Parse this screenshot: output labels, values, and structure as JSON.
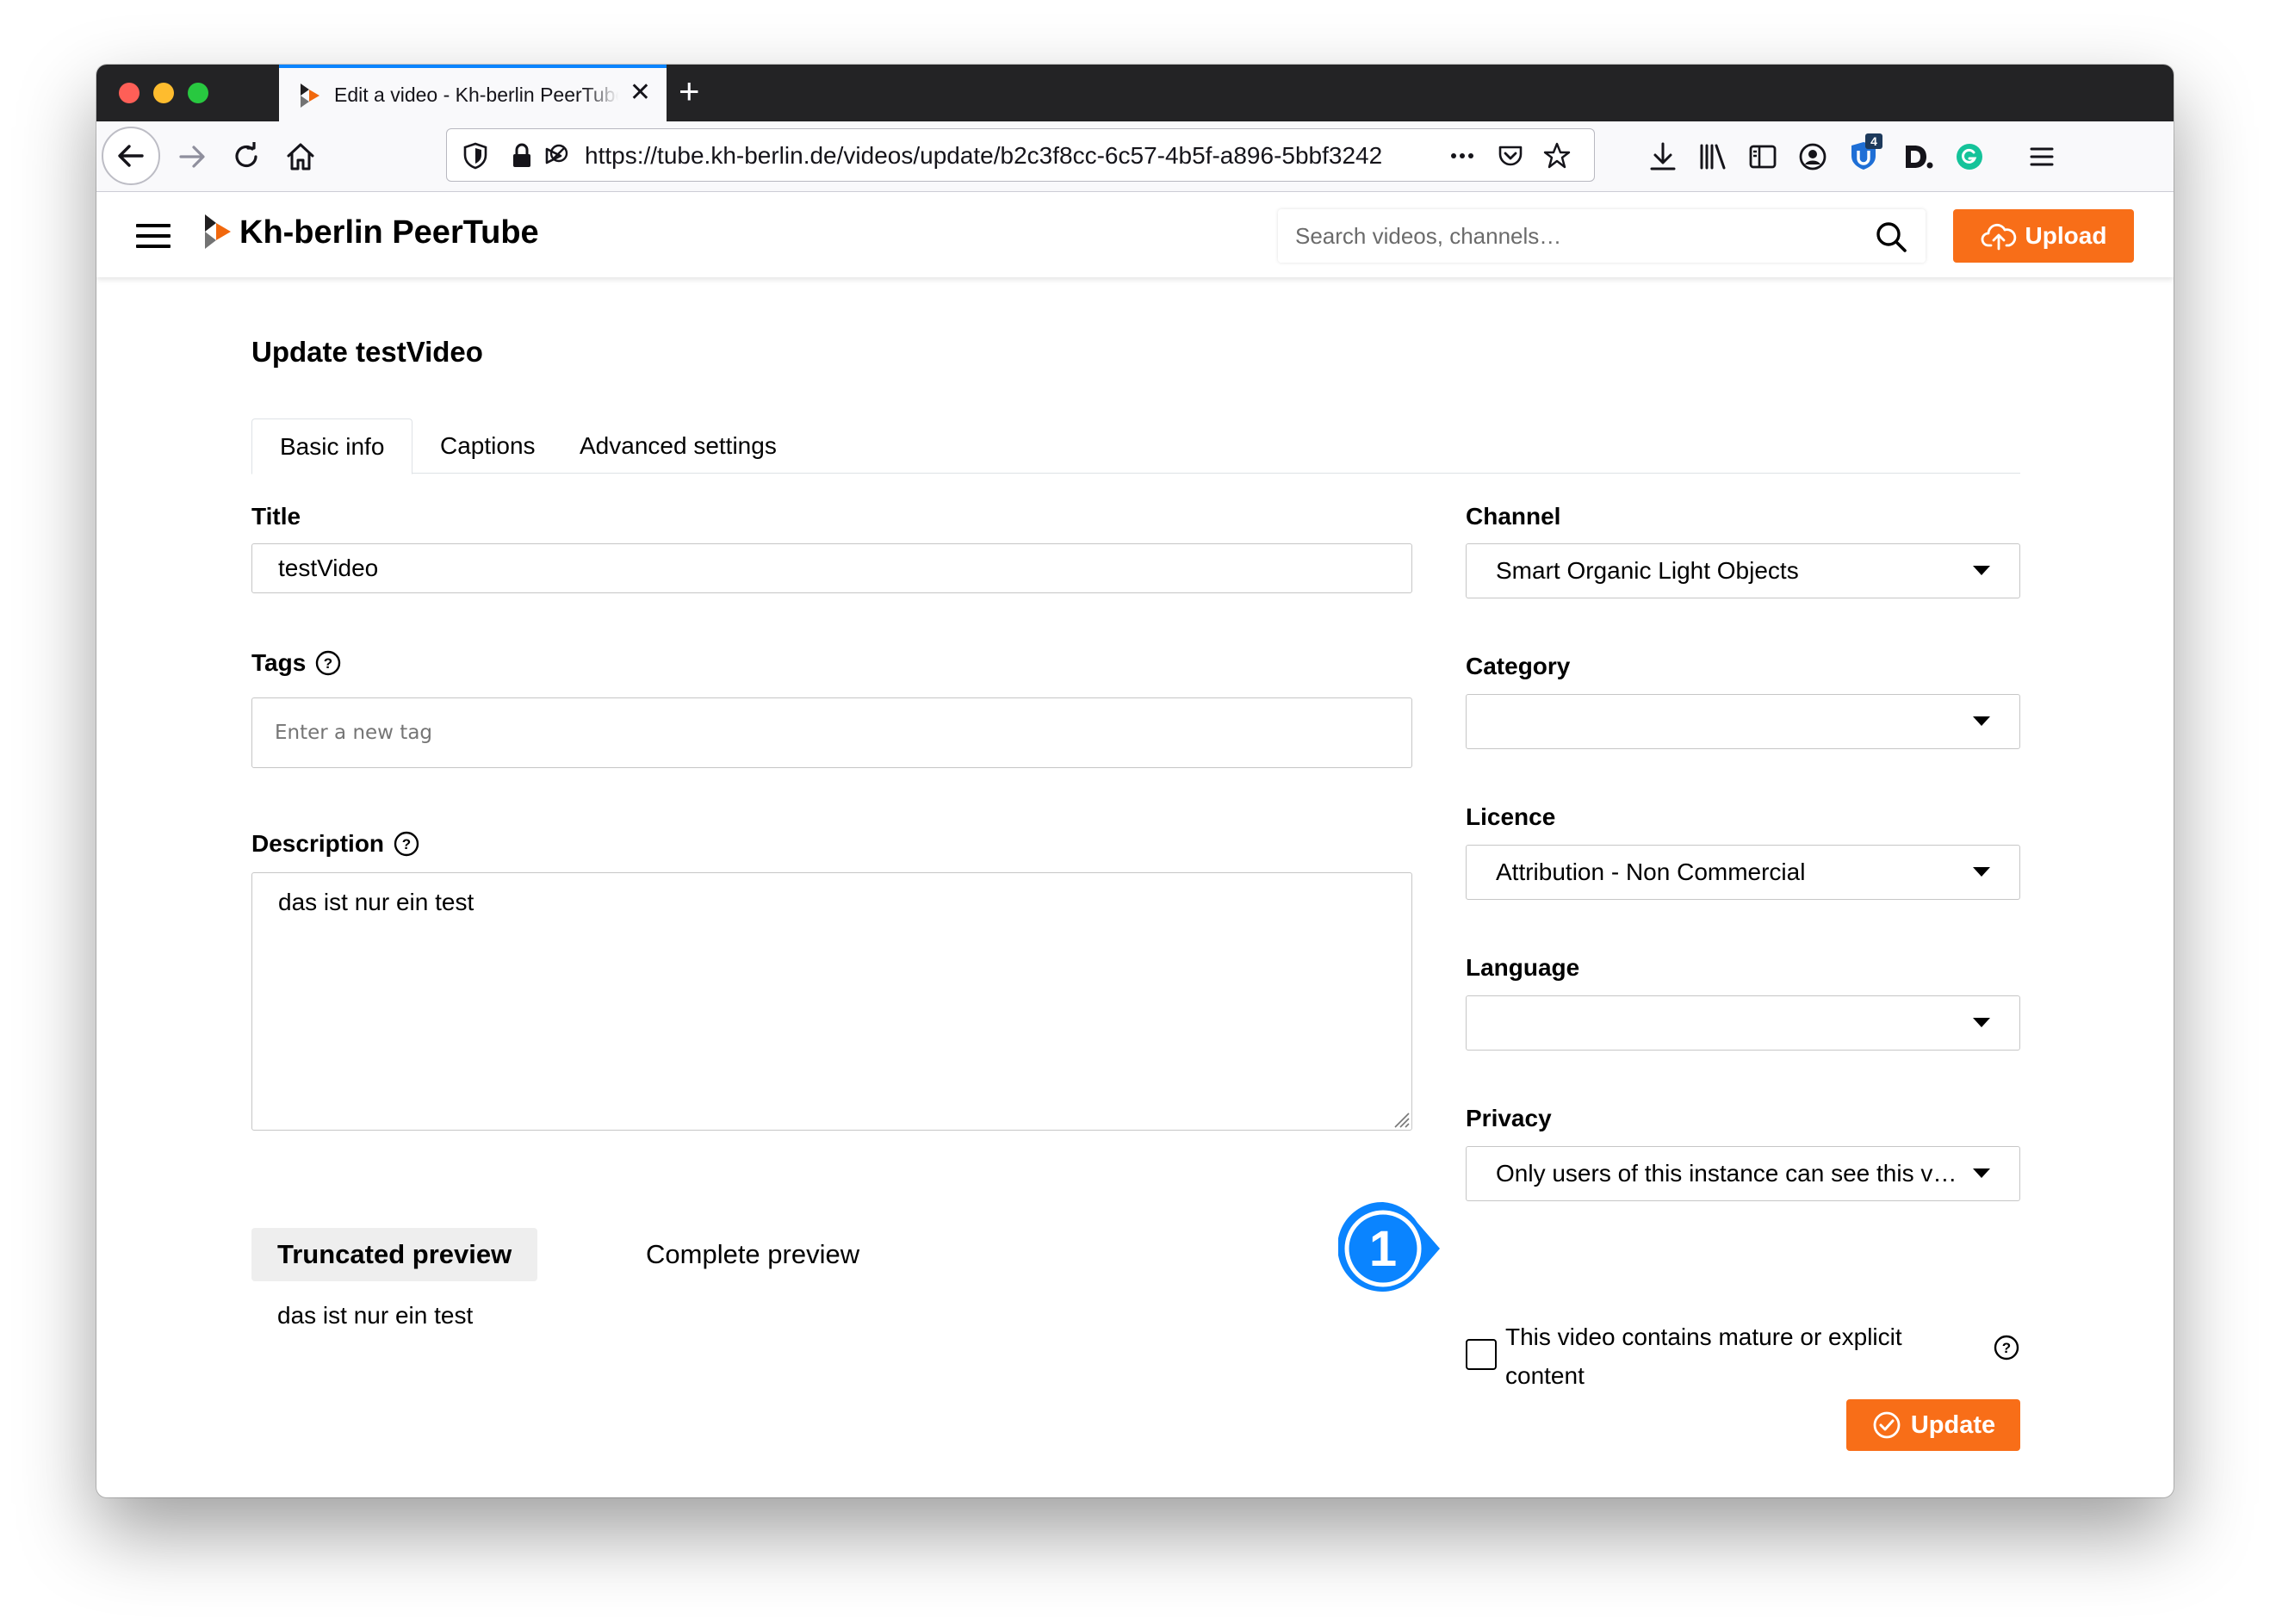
{
  "browser": {
    "tab_title": "Edit a video - Kh-berlin PeerTube",
    "url": "https://tube.kh-berlin.de/videos/update/b2c3f8cc-6c57-4b5f-a896-5bbf3242",
    "extension_badge": "4",
    "accent_color": "#0a84ff"
  },
  "header": {
    "brand": "Kh-berlin PeerTube",
    "search_placeholder": "Search videos, channels…",
    "upload_label": "Upload",
    "accent_color": "#f86e18"
  },
  "page": {
    "title": "Update testVideo",
    "tabs": [
      {
        "label": "Basic info",
        "active": true
      },
      {
        "label": "Captions",
        "active": false
      },
      {
        "label": "Advanced settings",
        "active": false
      }
    ]
  },
  "form": {
    "title_label": "Title",
    "title_value": "testVideo",
    "tags_label": "Tags",
    "tags_placeholder": "Enter a new tag",
    "description_label": "Description",
    "description_value": "das ist nur ein test",
    "preview_tabs": [
      {
        "label": "Truncated preview",
        "active": true
      },
      {
        "label": "Complete preview",
        "active": false
      }
    ],
    "preview_text": "das ist nur ein test",
    "channel_label": "Channel",
    "channel_value": "Smart Organic Light Objects",
    "category_label": "Category",
    "category_value": "",
    "licence_label": "Licence",
    "licence_value": "Attribution - Non Commercial",
    "language_label": "Language",
    "language_value": "",
    "privacy_label": "Privacy",
    "privacy_value": "Only users of this instance can see this vi…",
    "mature_label": "This video contains mature or explicit content",
    "mature_checked": false,
    "update_label": "Update"
  },
  "annotation": {
    "number": "1",
    "color": "#0a84ff"
  }
}
